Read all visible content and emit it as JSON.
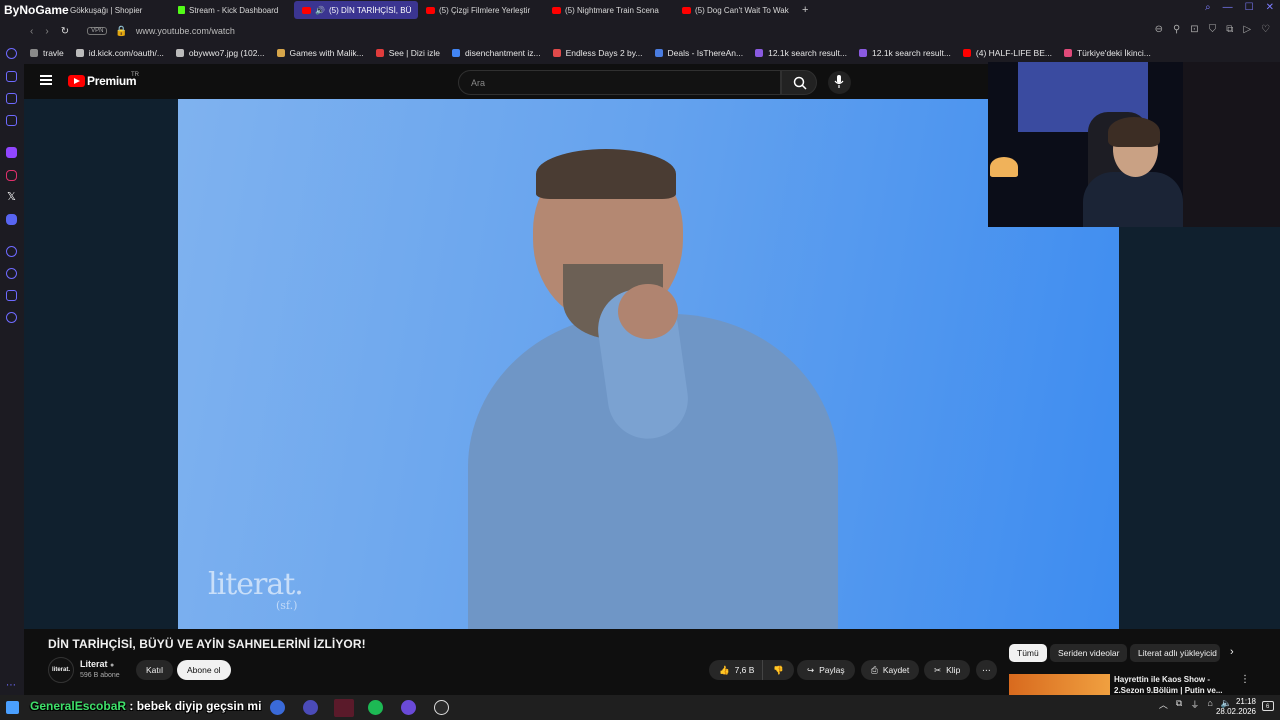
{
  "browser": {
    "brand": "ByNoGame",
    "tabs": [
      {
        "label": "Gökkuşağı | Shopier",
        "active": false,
        "icon": "tab-favicon"
      },
      {
        "label": "Stream - Kick Dashboard",
        "active": false,
        "icon": "kick-icon"
      },
      {
        "label": "(5) DİN TARİHÇİSİ, BÜ",
        "active": true,
        "icon": "youtube-icon"
      },
      {
        "label": "(5) Çizgi Filmlere Yerleştir",
        "active": false,
        "icon": "youtube-icon"
      },
      {
        "label": "(5) Nightmare Train Scena",
        "active": false,
        "icon": "youtube-icon"
      },
      {
        "label": "(5) Dog Can't Wait To Wak",
        "active": false,
        "icon": "youtube-icon"
      }
    ],
    "new_tab": "+",
    "vpn_label": "VPN",
    "url": "www.youtube.com/watch",
    "bookmarks": [
      {
        "label": "travle",
        "icon_color": "#8a8a8a"
      },
      {
        "label": "id.kick.com/oauth/...",
        "icon_color": "#bbbbbb"
      },
      {
        "label": "obywwo7.jpg (102...",
        "icon_color": "#bbbbbb"
      },
      {
        "label": "Games with Malik...",
        "icon_color": "#d6a54a"
      },
      {
        "label": "See | Dizi izle",
        "icon_color": "#e03c3c"
      },
      {
        "label": "disenchantment iz...",
        "icon_color": "#4285f4"
      },
      {
        "label": "Endless Days 2 by...",
        "icon_color": "#e04a4a"
      },
      {
        "label": "Deals - IsThereAn...",
        "icon_color": "#4a7ce0"
      },
      {
        "label": "12.1k search result...",
        "icon_color": "#8a5ae0"
      },
      {
        "label": "12.1k search result...",
        "icon_color": "#8a5ae0"
      },
      {
        "label": "(4) HALF-LIFE BE...",
        "icon_color": "#ff0000"
      },
      {
        "label": "Türkiye'deki İkinci...",
        "icon_color": "#e04a7a"
      }
    ]
  },
  "youtube": {
    "logo_text": "Premium",
    "region": "TR",
    "search_placeholder": "Ara",
    "video": {
      "watermark": "literat.",
      "watermark_sub": "(sf.)"
    },
    "title": "DİN TARİHÇİSİ, BÜYÜ VE AYİN SAHNELERİNİ İZLİYOR!",
    "channel": {
      "avatar_text": "literat.",
      "name": "Literat",
      "subscribers": "596 B abone",
      "join": "Katıl",
      "subscribe": "Abone ol"
    },
    "actions": {
      "likes": "7,6 B",
      "share": "Paylaş",
      "save": "Kaydet",
      "clip": "Klip"
    },
    "chips": [
      "Tümü",
      "Seriden videolar",
      "Literat adlı yükleyicid"
    ],
    "recommendation": {
      "title": "Hayrettin ile Kaos Show - 2.Sezon 9.Bölüm | Putin ve..."
    }
  },
  "taskbar": {
    "chat_user": "GeneralEscobaR",
    "chat_message": " : bebek diyip geçsin mi",
    "time": "21:18",
    "date": "28.02.2026",
    "notifications": "6"
  },
  "colors": {
    "accent": "#6e6aff",
    "youtube_red": "#ff0000",
    "active_tab": "#3b3591"
  }
}
